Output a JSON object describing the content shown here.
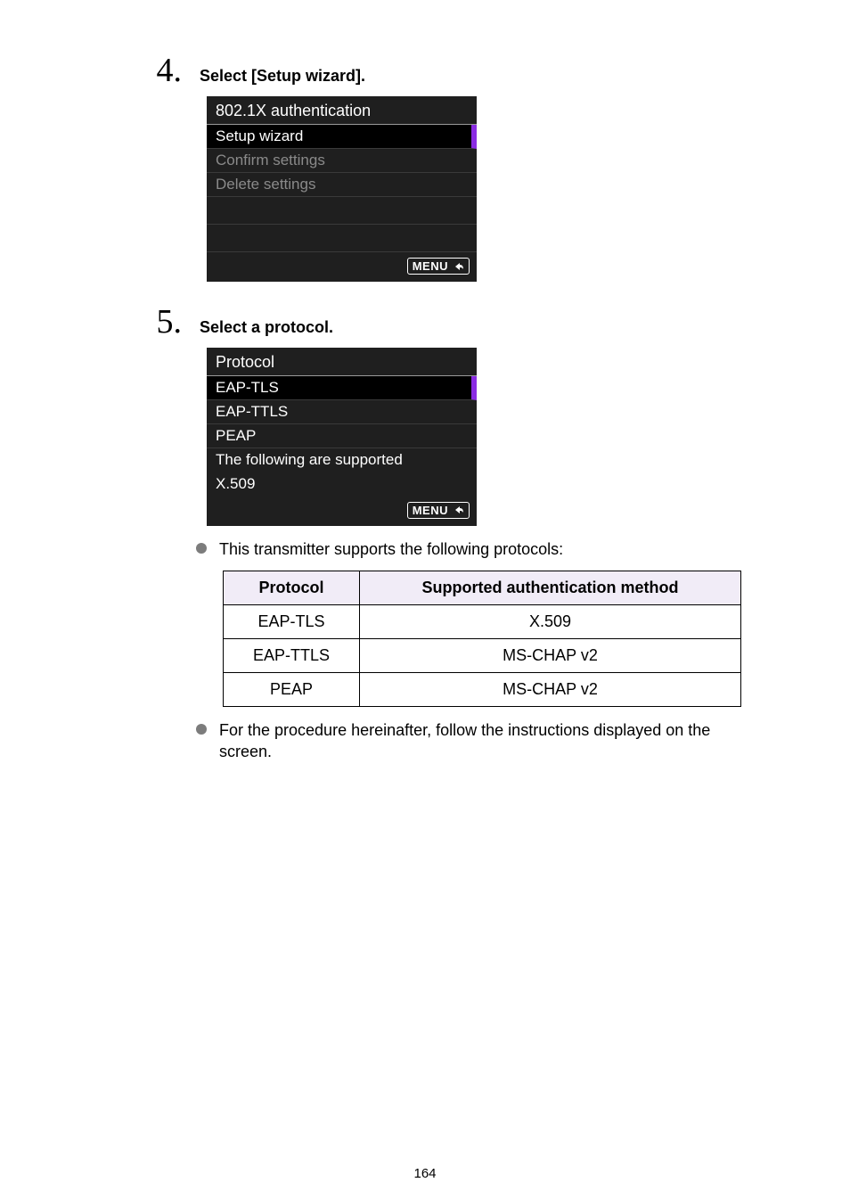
{
  "pageNumber": "164",
  "steps": [
    {
      "number": "4.",
      "title": "Select [Setup wizard].",
      "screen": {
        "title": "802.1X authentication",
        "rows": [
          {
            "label": "Setup wizard",
            "selected": true,
            "dim": false
          },
          {
            "label": "Confirm settings",
            "selected": false,
            "dim": true
          },
          {
            "label": "Delete settings",
            "selected": false,
            "dim": true
          }
        ],
        "emptyRows": 2,
        "menuLabel": "MENU"
      }
    },
    {
      "number": "5.",
      "title": "Select a protocol.",
      "screen": {
        "title": "Protocol",
        "rows": [
          {
            "label": "EAP-TLS",
            "selected": true,
            "dim": false
          },
          {
            "label": "EAP-TTLS",
            "selected": false,
            "dim": false
          },
          {
            "label": "PEAP",
            "selected": false,
            "dim": false
          }
        ],
        "noteLines": [
          "The following are supported",
          "X.509"
        ],
        "menuLabel": "MENU"
      },
      "bullets": [
        "This transmitter supports the following protocols:"
      ],
      "table": {
        "headers": [
          "Protocol",
          "Supported authentication method"
        ],
        "rows": [
          [
            "EAP-TLS",
            "X.509"
          ],
          [
            "EAP-TTLS",
            "MS-CHAP v2"
          ],
          [
            "PEAP",
            "MS-CHAP v2"
          ]
        ]
      },
      "bulletsAfter": [
        "For the procedure hereinafter, follow the instructions displayed on the screen."
      ]
    }
  ]
}
